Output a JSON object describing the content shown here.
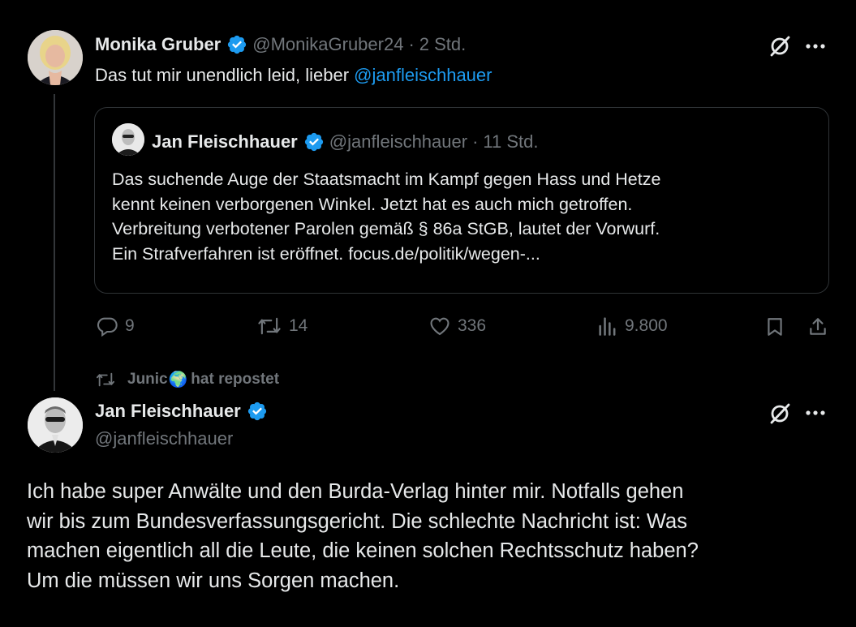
{
  "tweet1": {
    "author_name": "Monika Gruber",
    "handle": "@MonikaGruber24",
    "dot": "·",
    "time": "2 Std.",
    "text_prefix": "Das tut mir unendlich leid, lieber ",
    "mention": "@janfleischhauer",
    "avatar_icon": "monika-avatar"
  },
  "quote": {
    "author_name": "Jan Fleischhauer",
    "handle": "@janfleischhauer",
    "dot": "·",
    "time": "11 Std.",
    "lines": [
      "Das suchende Auge der Staatsmacht im Kampf gegen Hass und Hetze",
      "kennt keinen verborgenen Winkel. Jetzt hat es auch mich getroffen.",
      "Verbreitung verbotener Parolen gemäß § 86a StGB, lautet der Vorwurf.",
      "Ein Strafverfahren ist eröffnet. focus.de/politik/wegen-..."
    ]
  },
  "actions": {
    "replies": "9",
    "reposts": "14",
    "likes": "336",
    "views": "9.800"
  },
  "repost_banner": {
    "user": "Junic",
    "emoji": "🌍",
    "label": "hat repostet"
  },
  "tweet2": {
    "author_name": "Jan Fleischhauer",
    "handle": "@janfleischhauer",
    "lines": [
      "Ich habe super Anwälte und den Burda-Verlag hinter mir. Notfalls gehen",
      "wir bis zum Bundesverfassungsgericht. Die schlechte Nachricht ist: Was",
      "machen eigentlich all die Leute, die keinen solchen Rechtsschutz haben?",
      "Um die müssen wir uns Sorgen machen."
    ]
  },
  "colors": {
    "background": "#000000",
    "text": "#e7e9ea",
    "muted": "#71767b",
    "link": "#1d9bf0",
    "verified": "#1d9bf0",
    "border": "#2f3336"
  }
}
